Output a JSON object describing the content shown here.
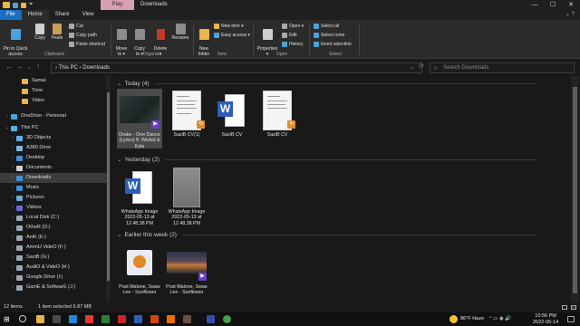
{
  "titlebar": {
    "context_tab": "Play",
    "title": "Downloads",
    "controls": [
      "—",
      "☐",
      "✕"
    ]
  },
  "ribbon_tabs": [
    "File",
    "Home",
    "Share",
    "View"
  ],
  "ribbon_right": "⌄  ?",
  "ribbon": {
    "clipboard": {
      "pin_label": "Pin to Quick\naccess",
      "copy_label": "Copy",
      "paste_label": "Paste",
      "cut_label": "Cut",
      "copy_path_label": "Copy path",
      "paste_shortcut_label": "Paste shortcut",
      "group_label": "Clipboard"
    },
    "organize": {
      "move_label": "Move\nto ▾",
      "copy_to_label": "Copy\nto ▾",
      "delete_label": "Delete\n▾",
      "rename_label": "Rename",
      "group_label": "Organize"
    },
    "new": {
      "new_folder_label": "New\nfolder",
      "new_item_label": "New item ▾",
      "easy_access_label": "Easy access ▾",
      "group_label": "New"
    },
    "open": {
      "properties_label": "Properties\n▾",
      "open_label": "Open ▾",
      "edit_label": "Edit",
      "history_label": "History",
      "group_label": "Open"
    },
    "select": {
      "select_all_label": "Select all",
      "select_none_label": "Select none",
      "invert_label": "Invert selection",
      "group_label": "Select"
    }
  },
  "address": {
    "path": "›  This PC  ›  Downloads",
    "search_placeholder": "Search Downloads"
  },
  "navpane": {
    "items": [
      {
        "label": "Samai",
        "icon": "folder-icon",
        "color": "#e8b64a",
        "indent": 2,
        "chev": ""
      },
      {
        "label": "Time",
        "icon": "folder-icon",
        "color": "#e8b64a",
        "indent": 2,
        "chev": ""
      },
      {
        "label": "Video",
        "icon": "folder-icon",
        "color": "#e8b64a",
        "indent": 2,
        "chev": ""
      },
      {
        "label": "OneDrive - Personal",
        "icon": "cloud-icon",
        "color": "#4aa3df",
        "indent": 0,
        "chev": "›"
      },
      {
        "label": "This PC",
        "icon": "computer-icon",
        "color": "#5ab0e6",
        "indent": 0,
        "chev": "⌄"
      },
      {
        "label": "3D Objects",
        "icon": "cube-icon",
        "color": "#5ab0e6",
        "indent": 1,
        "chev": "›"
      },
      {
        "label": "A380 Drive",
        "icon": "drive-icon",
        "color": "#7fb7e0",
        "indent": 1,
        "chev": "›"
      },
      {
        "label": "Desktop",
        "icon": "desktop-icon",
        "color": "#3f8fd6",
        "indent": 1,
        "chev": "›"
      },
      {
        "label": "Documents",
        "icon": "documents-icon",
        "color": "#cfcfcf",
        "indent": 1,
        "chev": "›"
      },
      {
        "label": "Downloads",
        "icon": "download-icon",
        "color": "#3f8fd6",
        "indent": 1,
        "chev": "›"
      },
      {
        "label": "Music",
        "icon": "music-icon",
        "color": "#3f8fd6",
        "indent": 1,
        "chev": "›"
      },
      {
        "label": "Pictures",
        "icon": "pictures-icon",
        "color": "#6aa8d8",
        "indent": 1,
        "chev": "›"
      },
      {
        "label": "Videos",
        "icon": "videos-icon",
        "color": "#6a6ad8",
        "indent": 1,
        "chev": "›"
      },
      {
        "label": "Local Disk (C:)",
        "icon": "disk-icon",
        "color": "#9aa7b3",
        "indent": 1,
        "chev": "›"
      },
      {
        "label": "OtheR (D:)",
        "icon": "disk-icon",
        "color": "#9aa7b3",
        "indent": 1,
        "chev": "›"
      },
      {
        "label": "AniK (E:)",
        "icon": "disk-icon",
        "color": "#9aa7b3",
        "indent": 1,
        "chev": "›"
      },
      {
        "label": "AmmU VideO (F:)",
        "icon": "disk-icon",
        "color": "#9aa7b3",
        "indent": 1,
        "chev": "›"
      },
      {
        "label": "SaziB (G:)",
        "icon": "disk-icon",
        "color": "#9aa7b3",
        "indent": 1,
        "chev": "›"
      },
      {
        "label": "AudiO & VideO (H:)",
        "icon": "disk-icon",
        "color": "#9aa7b3",
        "indent": 1,
        "chev": "›"
      },
      {
        "label": "Google Drive (I:)",
        "icon": "disk-icon",
        "color": "#9aa7b3",
        "indent": 1,
        "chev": "›"
      },
      {
        "label": "GamE & SoftwarE (J:)",
        "icon": "disk-icon",
        "color": "#9aa7b3",
        "indent": 1,
        "chev": "›"
      }
    ],
    "selected_index": 9
  },
  "groups": [
    {
      "header": "Today (4)"
    },
    {
      "header": "Yesterday (2)"
    },
    {
      "header": "Earlier this week (2)"
    }
  ],
  "files": {
    "drake": {
      "label": "Drake - One Dance (Lyrics) ft. Wizkid & Kyla",
      "badge": "▶"
    },
    "sazib_cv1": {
      "label": "SaziB CV(1)",
      "badge": "⟲"
    },
    "sazib_cv_word": {
      "label": "SaziB CV",
      "badge_letter": "W"
    },
    "sazib_cv2": {
      "label": "SaziB CV",
      "badge": "⟲"
    },
    "whatsapp1": {
      "label": "WhatsApp Image 2022-05-13 at 12.48.38 PM",
      "badge_letter": "W"
    },
    "whatsapp2": {
      "label": "WhatsApp Image 2022-05-13 at 12.48.38 PM"
    },
    "post1": {
      "label": "Post Malone, Swae Lee - Sunflower"
    },
    "post2": {
      "label": "Post Malone, Swae Lee - Sunflower",
      "badge": "▶"
    }
  },
  "status": {
    "count": "12 items",
    "selected": "1 item selected  6.87 MB"
  },
  "taskbar": {
    "weather": "86°F  Haze",
    "time": "10:56 PM",
    "date": "2022-05-14"
  },
  "colors": {
    "accent": "#1a6fc4",
    "context_tab": "#d89fb3",
    "video_badge": "#6b3fc9",
    "shortcut_badge": "#e08a2a"
  }
}
